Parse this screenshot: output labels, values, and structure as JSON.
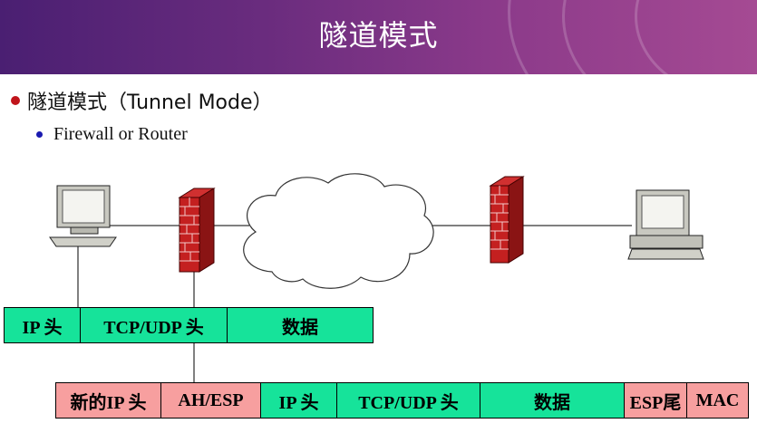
{
  "slide": {
    "title": "隧道模式",
    "bullet": "隧道模式（Tunnel Mode）",
    "sub_bullet": "Firewall or Router"
  },
  "packet_original": [
    {
      "label": "IP 头",
      "color": "#16e39a"
    },
    {
      "label": "TCP/UDP 头",
      "color": "#16e39a"
    },
    {
      "label": "数据",
      "color": "#16e39a"
    }
  ],
  "packet_tunnel": [
    {
      "label": "新的IP 头",
      "color": "#f79f9f"
    },
    {
      "label": "AH/ESP",
      "color": "#f79f9f"
    },
    {
      "label": "IP 头",
      "color": "#16e39a"
    },
    {
      "label": "TCP/UDP 头",
      "color": "#16e39a"
    },
    {
      "label": "数据",
      "color": "#16e39a"
    },
    {
      "label": "ESP尾",
      "color": "#f79f9f"
    },
    {
      "label": "MAC",
      "color": "#f79f9f"
    }
  ],
  "icons": [
    "desktop-computer-icon",
    "firewall-icon",
    "internet-cloud-icon",
    "firewall-icon",
    "workstation-computer-icon"
  ]
}
